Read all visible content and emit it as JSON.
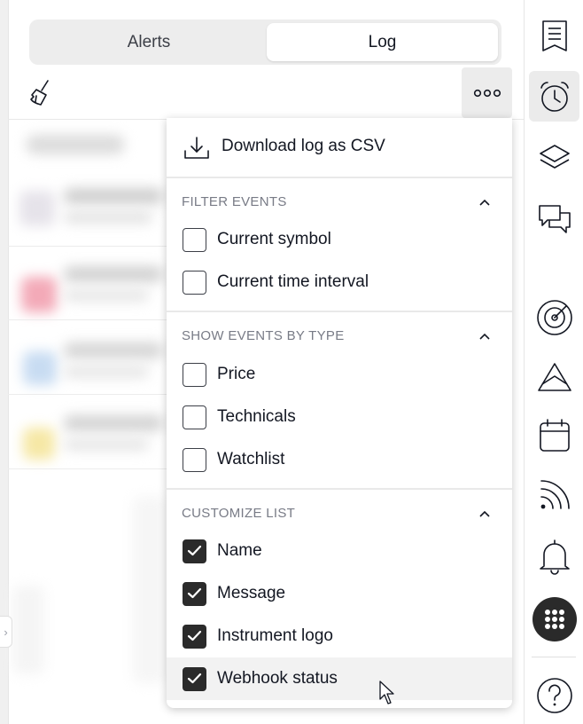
{
  "tabs": {
    "alerts_label": "Alerts",
    "log_label": "Log",
    "selected": "Log"
  },
  "toolbar_top": {
    "clear_icon": "broom-icon",
    "more_icon": "more-horizontal-icon"
  },
  "menu": {
    "download_label": "Download log as CSV",
    "download_icon": "download-icon",
    "sections": [
      {
        "title": "FILTER EVENTS",
        "items": [
          {
            "label": "Current symbol",
            "checked": false
          },
          {
            "label": "Current time interval",
            "checked": false
          }
        ]
      },
      {
        "title": "SHOW EVENTS BY TYPE",
        "items": [
          {
            "label": "Price",
            "checked": false
          },
          {
            "label": "Technicals",
            "checked": false
          },
          {
            "label": "Watchlist",
            "checked": false
          }
        ]
      },
      {
        "title": "CUSTOMIZE LIST",
        "items": [
          {
            "label": "Name",
            "checked": true
          },
          {
            "label": "Message",
            "checked": true
          },
          {
            "label": "Instrument logo",
            "checked": true
          },
          {
            "label": "Webhook status",
            "checked": true
          }
        ]
      }
    ]
  },
  "right_toolbar": [
    {
      "icon": "watchlist-icon",
      "active": false
    },
    {
      "icon": "alarm-clock-icon",
      "active": true
    },
    {
      "icon": "layers-icon",
      "active": false
    },
    {
      "icon": "chat-icon",
      "active": false
    },
    {
      "icon": "radar-icon",
      "active": false
    },
    {
      "icon": "ideas-mountain-icon",
      "active": false
    },
    {
      "icon": "calendar-icon",
      "active": false
    },
    {
      "icon": "news-feed-icon",
      "active": false
    },
    {
      "icon": "bell-icon",
      "active": false
    },
    {
      "icon": "apps-grid-icon",
      "active": false
    },
    {
      "icon": "help-icon",
      "active": false
    }
  ],
  "colors": {
    "accent_dark": "#2b2b2b",
    "active_bg": "#ebebeb",
    "section_title": "#787b86"
  }
}
